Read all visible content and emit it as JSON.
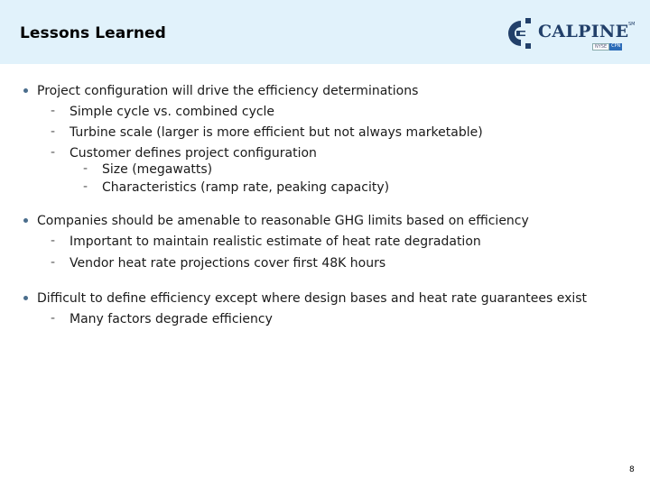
{
  "header": {
    "title": "Lessons Learned",
    "logo": {
      "name": "CALPINE",
      "tm": "SM",
      "tag1": "NYSE",
      "tag2": "CPN",
      "brand_color": "#22406a"
    }
  },
  "bullets": [
    {
      "text": "Project configuration will drive the efficiency determinations",
      "subs": [
        {
          "text": "Simple cycle vs. combined cycle"
        },
        {
          "text": "Turbine scale (larger is more efficient but not always marketable)"
        },
        {
          "text": "Customer defines project configuration",
          "subs": [
            {
              "text": "Size (megawatts)"
            },
            {
              "text": "Characteristics (ramp rate, peaking capacity)"
            }
          ]
        }
      ]
    },
    {
      "text": "Companies should be amenable to reasonable GHG limits based on efficiency",
      "subs": [
        {
          "text": "Important to maintain realistic estimate of heat rate degradation"
        },
        {
          "text": "Vendor heat rate projections cover first 48K hours"
        }
      ]
    },
    {
      "text": "Difficult to define efficiency except where design bases and heat rate guarantees exist",
      "subs": [
        {
          "text": "Many factors degrade efficiency"
        }
      ]
    }
  ],
  "dash_glyph": "-",
  "footer": {
    "page_number": "8"
  }
}
